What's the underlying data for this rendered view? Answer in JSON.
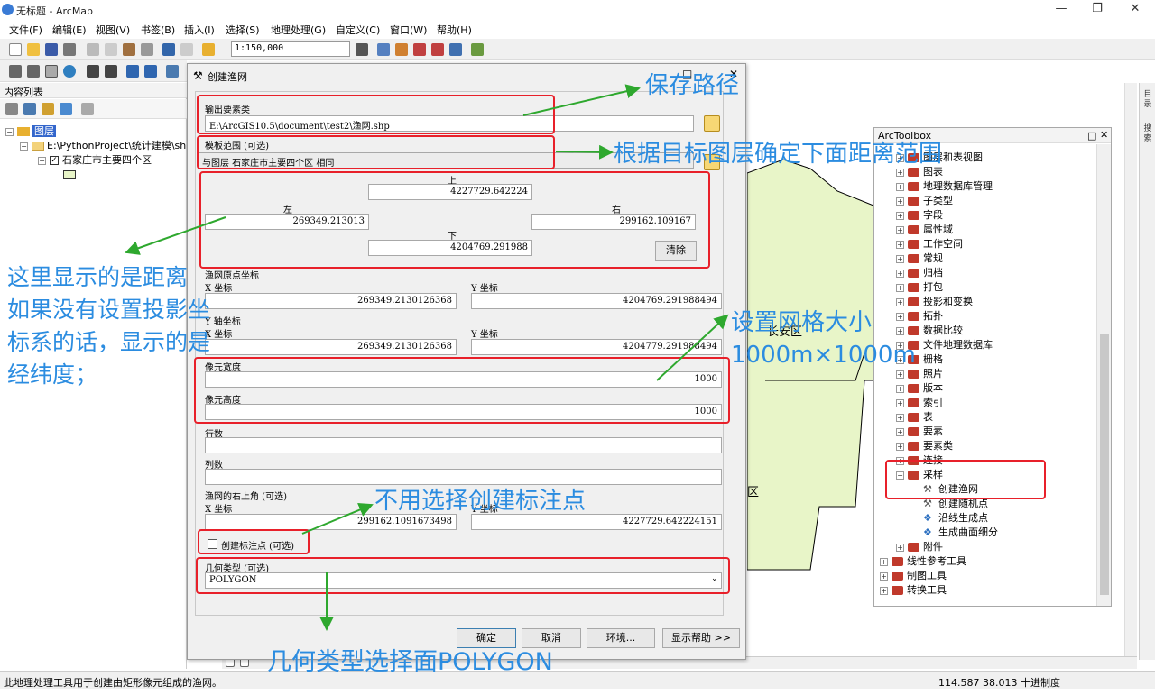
{
  "window": {
    "title": "无标题 - ArcMap"
  },
  "menu": [
    "文件(F)",
    "编辑(E)",
    "视图(V)",
    "书签(B)",
    "插入(I)",
    "选择(S)",
    "地理处理(G)",
    "自定义(C)",
    "窗口(W)",
    "帮助(H)"
  ],
  "toolbar": {
    "scale": "1:150,000"
  },
  "toc": {
    "title": "内容列表",
    "layers_root": "图层",
    "folder": "E:\\PythonProject\\统计建模\\shp",
    "layer": "石家庄市主要四个区"
  },
  "dialog": {
    "title": "创建渔网",
    "output_label": "输出要素类",
    "output_value": "E:\\ArcGIS10.5\\document\\test2\\渔网.shp",
    "template_label": "模板范围 (可选)",
    "template_value": "与图层 石家庄市主要四个区 相同",
    "extent": {
      "top_label": "上",
      "top": "4227729.642224",
      "left_label": "左",
      "left": "269349.213013",
      "right_label": "右",
      "right": "299162.109167",
      "bottom_label": "下",
      "bottom": "4204769.291988",
      "clear": "清除"
    },
    "origin_label": "渔网原点坐标",
    "origin_x_label": "X 坐标",
    "origin_x": "269349.2130126368",
    "origin_y_label": "Y 坐标",
    "origin_y": "4204769.291988494",
    "yaxis_label": "Y 轴坐标",
    "yaxis_x_label": "X 坐标",
    "yaxis_x": "269349.2130126368",
    "yaxis_y_label": "Y 坐标",
    "yaxis_y": "4204779.291988494",
    "cell_width_label": "像元宽度",
    "cell_width": "1000",
    "cell_height_label": "像元高度",
    "cell_height": "1000",
    "rows_label": "行数",
    "rows": "",
    "cols_label": "列数",
    "cols": "",
    "corner_label": "渔网的右上角 (可选)",
    "corner_x_label": "X 坐标",
    "corner_x": "299162.1091673498",
    "corner_y_label": "Y 坐标",
    "corner_y": "4227729.642224151",
    "labels_checkbox": "创建标注点 (可选)",
    "geom_label": "几何类型 (可选)",
    "geom_value": "POLYGON",
    "buttons": {
      "ok": "确定",
      "cancel": "取消",
      "env": "环境...",
      "help": "显示帮助 >>"
    }
  },
  "map": {
    "district_label": "长安区",
    "district_label2": "区"
  },
  "arctoolbox": {
    "title": "ArcToolbox",
    "items": [
      "图层和表视图",
      "图表",
      "地理数据库管理",
      "子类型",
      "字段",
      "属性域",
      "工作空间",
      "常规",
      "归档",
      "打包",
      "投影和变换",
      "拓扑",
      "数据比较",
      "文件地理数据库",
      "栅格",
      "照片",
      "版本",
      "索引",
      "表",
      "要素",
      "要素类",
      "连接"
    ],
    "sampling": "采样",
    "sampling_tools": [
      "创建渔网",
      "创建随机点",
      "沿线生成点",
      "生成曲面细分"
    ],
    "after": [
      "附件"
    ],
    "top_level": [
      "线性参考工具",
      "制图工具",
      "转换工具"
    ]
  },
  "side_tabs": [
    "目录",
    "搜索"
  ],
  "status": {
    "message": "此地理处理工具用于创建由矩形像元组成的渔网。",
    "coords": "114.587  38.013 十进制度"
  },
  "annotations": {
    "save_path": "保存路径",
    "extent_note": "根据目标图层确定下面距离范围",
    "distance_note": [
      "这里显示的是距离",
      "如果没有设置投影坐",
      "标系的话，显示的是",
      "经纬度；"
    ],
    "grid_note": [
      "设置网格大小",
      "1000m×1000m"
    ],
    "label_note": "不用选择创建标注点",
    "geom_note": "几何类型选择面POLYGON"
  },
  "colors": {
    "annotation": "#2b8ce0",
    "highlight": "#e8202a",
    "arrow": "#2ea82e",
    "district_fill": "#e8f5c8"
  }
}
